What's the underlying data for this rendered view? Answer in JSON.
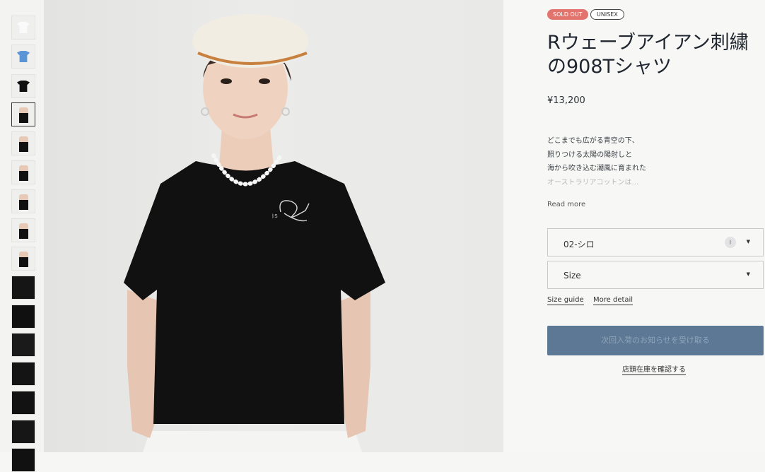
{
  "thumbnails": [
    {
      "name": "thumb-white-tee",
      "kind": "tee",
      "color": "#fafafa"
    },
    {
      "name": "thumb-blue-tee",
      "kind": "tee",
      "color": "#5a93d6"
    },
    {
      "name": "thumb-black-tee",
      "kind": "tee",
      "color": "#111111"
    },
    {
      "name": "thumb-model-front",
      "kind": "model",
      "color": "#111111",
      "active": true
    },
    {
      "name": "thumb-model-2",
      "kind": "model",
      "color": "#111111"
    },
    {
      "name": "thumb-model-3",
      "kind": "model",
      "color": "#111111"
    },
    {
      "name": "thumb-model-4",
      "kind": "model",
      "color": "#111111"
    },
    {
      "name": "thumb-model-5",
      "kind": "model",
      "color": "#111111"
    },
    {
      "name": "thumb-model-6",
      "kind": "model",
      "color": "#111111"
    },
    {
      "name": "thumb-detail-1",
      "kind": "fabric",
      "color": "#151515"
    },
    {
      "name": "thumb-detail-2",
      "kind": "fabric",
      "color": "#101010"
    },
    {
      "name": "thumb-detail-3",
      "kind": "fabric",
      "color": "#1a1a1a"
    },
    {
      "name": "thumb-detail-4",
      "kind": "fabric",
      "color": "#141414"
    },
    {
      "name": "thumb-detail-5",
      "kind": "fabric",
      "color": "#121212"
    },
    {
      "name": "thumb-detail-6",
      "kind": "fabric",
      "color": "#161616"
    },
    {
      "name": "thumb-detail-7",
      "kind": "fabric",
      "color": "#111111"
    }
  ],
  "product": {
    "badges": {
      "sold_out": "SOLD OUT",
      "unisex": "UNISEX"
    },
    "title": "Rウェーブアイアン刺繍の908Tシャツ",
    "price": "¥13,200",
    "description": [
      "どこまでも広がる青空の下、",
      "照りつける太陽の陽射しと",
      "海から吹き込む潮風に育まれた",
      "オーストラリアコットンは…"
    ],
    "read_more": "Read more",
    "color_select": {
      "value": "02-シロ",
      "swatch_icon": "logo-swatch-icon"
    },
    "size_select": {
      "value": "Size"
    },
    "size_guide": "Size guide",
    "more_detail": "More detail",
    "notify_button": "次回入荷のお知らせを受け取る",
    "store_stock": "店頭在庫を確認する"
  },
  "colors": {
    "sold_out": "#e3736d",
    "cta": "#5c7895",
    "shirt": "#111111"
  }
}
